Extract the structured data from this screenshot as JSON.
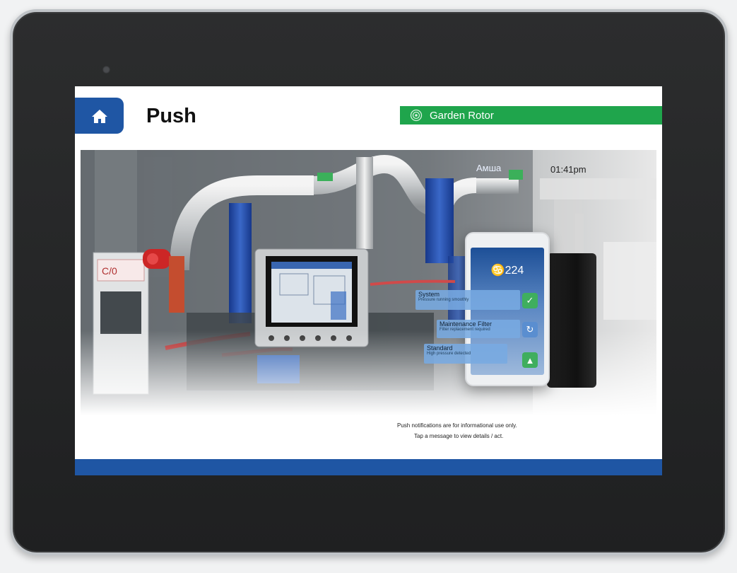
{
  "header": {
    "title": "Push",
    "garden_label": "Garden Rotor"
  },
  "status": {
    "time": "01:41pm"
  },
  "photo": {
    "panel_tag": "C/0",
    "valve_label": "Aмшa"
  },
  "phone": {
    "notification_count": "224",
    "notifications": [
      {
        "title": "System",
        "detail": "Pressure running smoothly"
      },
      {
        "title": "Maintenance Filter",
        "detail": "Filter replacement required"
      },
      {
        "title": "Standard",
        "detail": "High pressure detected"
      }
    ]
  },
  "notes": {
    "line1": "Push notifications are for informational use only.",
    "line2": "Tap a message to view details / act."
  },
  "colors": {
    "primary": "#1f56a4",
    "garden": "#1fa54c",
    "notification": "#78aae1"
  },
  "icons": [
    "home-icon",
    "garden-rotor-icon",
    "bell-icon",
    "check-icon",
    "refresh-icon",
    "up-arrow-icon"
  ]
}
